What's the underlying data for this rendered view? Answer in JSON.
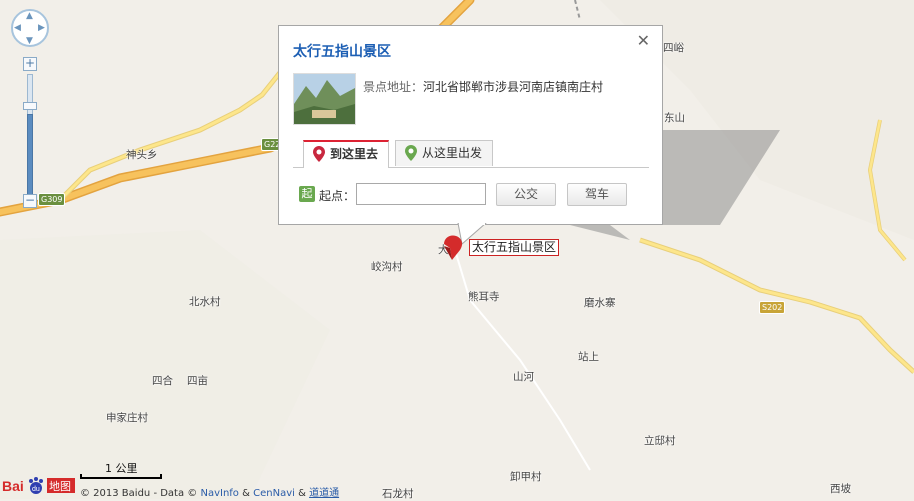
{
  "map": {
    "places": [
      {
        "id": "shentou",
        "name": "神头乡"
      },
      {
        "id": "siling",
        "name": "四峪"
      },
      {
        "id": "dongshan",
        "name": "东山"
      },
      {
        "id": "jiaogou",
        "name": "峧沟村"
      },
      {
        "id": "xiong_er",
        "name": "熊耳寺"
      },
      {
        "id": "beishui",
        "name": "北水村"
      },
      {
        "id": "moshui",
        "name": "磨水寨"
      },
      {
        "id": "zhanshang",
        "name": "站上"
      },
      {
        "id": "sihe",
        "name": "四合"
      },
      {
        "id": "simiao",
        "name": "四亩"
      },
      {
        "id": "shanhe",
        "name": "山河"
      },
      {
        "id": "shenjia",
        "name": "申家庄村"
      },
      {
        "id": "liqiao",
        "name": "立邸村"
      },
      {
        "id": "xijia",
        "name": "卸甲村"
      },
      {
        "id": "xipo",
        "name": "西坡"
      },
      {
        "id": "shilong",
        "name": "石龙村"
      },
      {
        "id": "dazhai",
        "name": "大"
      }
    ],
    "roads": {
      "g309": "G309",
      "g22": "G22",
      "s202": "S202"
    }
  },
  "info_window": {
    "title": "太行五指山景区",
    "address_key": "景点地址：",
    "address_value": "河北省邯郸市涉县河南店镇南庄村",
    "tabs": [
      {
        "label": "到这里去",
        "active": true
      },
      {
        "label": "从这里出发",
        "active": false
      }
    ],
    "start_badge": "起",
    "start_label": "起点：",
    "start_value": "",
    "btn_bus": "公交",
    "btn_car": "驾车"
  },
  "marker": {
    "label": "太行五指山景区"
  },
  "scale": {
    "label": "1 公里"
  },
  "footer": {
    "logo_text": "Bai",
    "logo_text2": "地图",
    "copyright": "© 2013 Baidu - Data ©",
    "navinfo": "NavInfo",
    "amp1": "&",
    "cennavi": "CenNavi",
    "amp2": "&",
    "daodaotong": "道道通"
  },
  "colors": {
    "highway": "#f5b64a",
    "road": "#fde68b",
    "land": "#f2efe9",
    "title_blue": "#1d5fb4",
    "marker_red": "#d42b2b"
  }
}
